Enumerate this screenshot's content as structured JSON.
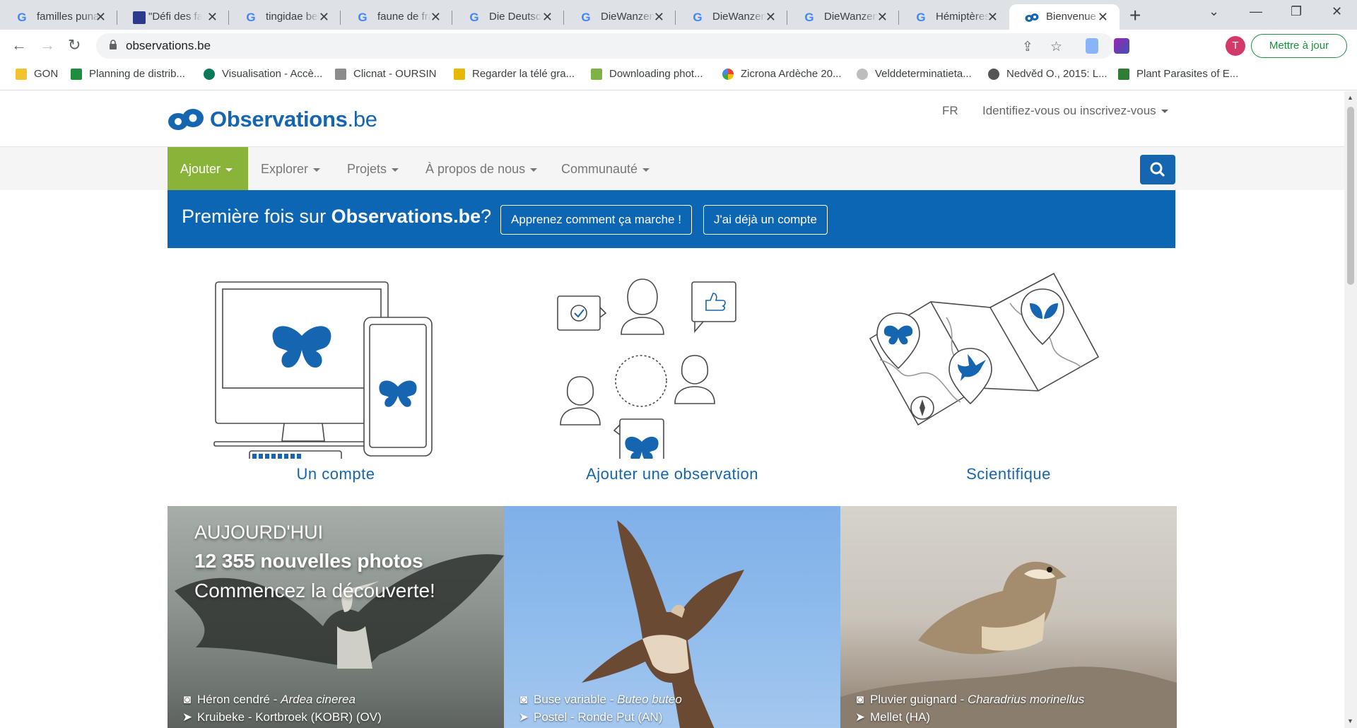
{
  "browser": {
    "tabs": [
      {
        "title": "familles punaises",
        "favicon": "google-icon"
      },
      {
        "title": "\"Défi des familles",
        "favicon": "site-icon"
      },
      {
        "title": "tingidae belgique",
        "favicon": "google-icon"
      },
      {
        "title": "faune de france",
        "favicon": "google-icon"
      },
      {
        "title": "Die Deutschen",
        "favicon": "google-icon"
      },
      {
        "title": "DieWanzen",
        "favicon": "google-icon"
      },
      {
        "title": "DieWanzen",
        "favicon": "google-icon"
      },
      {
        "title": "DieWanzen",
        "favicon": "google-icon"
      },
      {
        "title": "Hémiptères",
        "favicon": "google-icon"
      },
      {
        "title": "Bienvenue",
        "favicon": "observations-icon",
        "active": true
      }
    ],
    "url": "observations.be",
    "update_button": "Mettre à jour",
    "profile_initial": "T",
    "bookmarks": [
      {
        "label": "GON",
        "icon": "folder-icon",
        "color": "#f2c230"
      },
      {
        "label": "Planning de distrib...",
        "icon": "sheets-icon",
        "color": "#1e8e3e"
      },
      {
        "label": "Visualisation - Accè...",
        "icon": "circle-icon",
        "color": "#0b7a5b"
      },
      {
        "label": "Clicnat - OURSIN",
        "icon": "clicnat-icon",
        "color": "#8c8c8c"
      },
      {
        "label": "Regarder la télé gra...",
        "icon": "tv-icon",
        "color": "#e6b800"
      },
      {
        "label": "Downloading phot...",
        "icon": "bird-icon",
        "color": "#7cb342"
      },
      {
        "label": "Zicrona Ardèche 20...",
        "icon": "photos-icon",
        "color": "#ea4335"
      },
      {
        "label": "Velddeterminatieta...",
        "icon": "leaf-icon",
        "color": "#9e9e9e"
      },
      {
        "label": "Nedvěd O., 2015: L...",
        "icon": "bug-icon",
        "color": "#555555"
      },
      {
        "label": "Plant Parasites of E...",
        "icon": "plant-icon",
        "color": "#2e7d32"
      }
    ]
  },
  "site": {
    "brand": "Observations",
    "tld": ".be",
    "lang": "FR",
    "login": "Identifiez-vous ou inscrivez-vous",
    "nav": [
      "Ajouter",
      "Explorer",
      "Projets",
      "À propos de nous",
      "Communauté"
    ],
    "banner": {
      "prefix": "Première fois sur ",
      "brand": "Observations.be",
      "suffix": "?",
      "btn_how": "Apprenez comment ça marche !",
      "btn_account": "J'ai déjà un compte"
    },
    "features": [
      "Un compte",
      "Ajouter une observation",
      "Scientifique"
    ],
    "hero": {
      "line1": "AUJOURD'HUI",
      "line2": "12 355 nouvelles photos",
      "line3": "Commencez la découverte!"
    },
    "photos": [
      {
        "species": "Héron cendré",
        "latin": "Ardea cinerea",
        "location": "Kruibeke - Kortbroek (KOBR) (OV)"
      },
      {
        "species": "Buse variable",
        "latin": "Buteo buteo",
        "location": "Postel - Ronde Put (AN)"
      },
      {
        "species": "Pluvier guignard",
        "latin": "Charadrius morinellus",
        "location": "Mellet (HA)"
      }
    ],
    "colors": {
      "brand_blue": "#1565b0",
      "banner_blue": "#0d66b3",
      "accent_green": "#8ab33a"
    }
  }
}
